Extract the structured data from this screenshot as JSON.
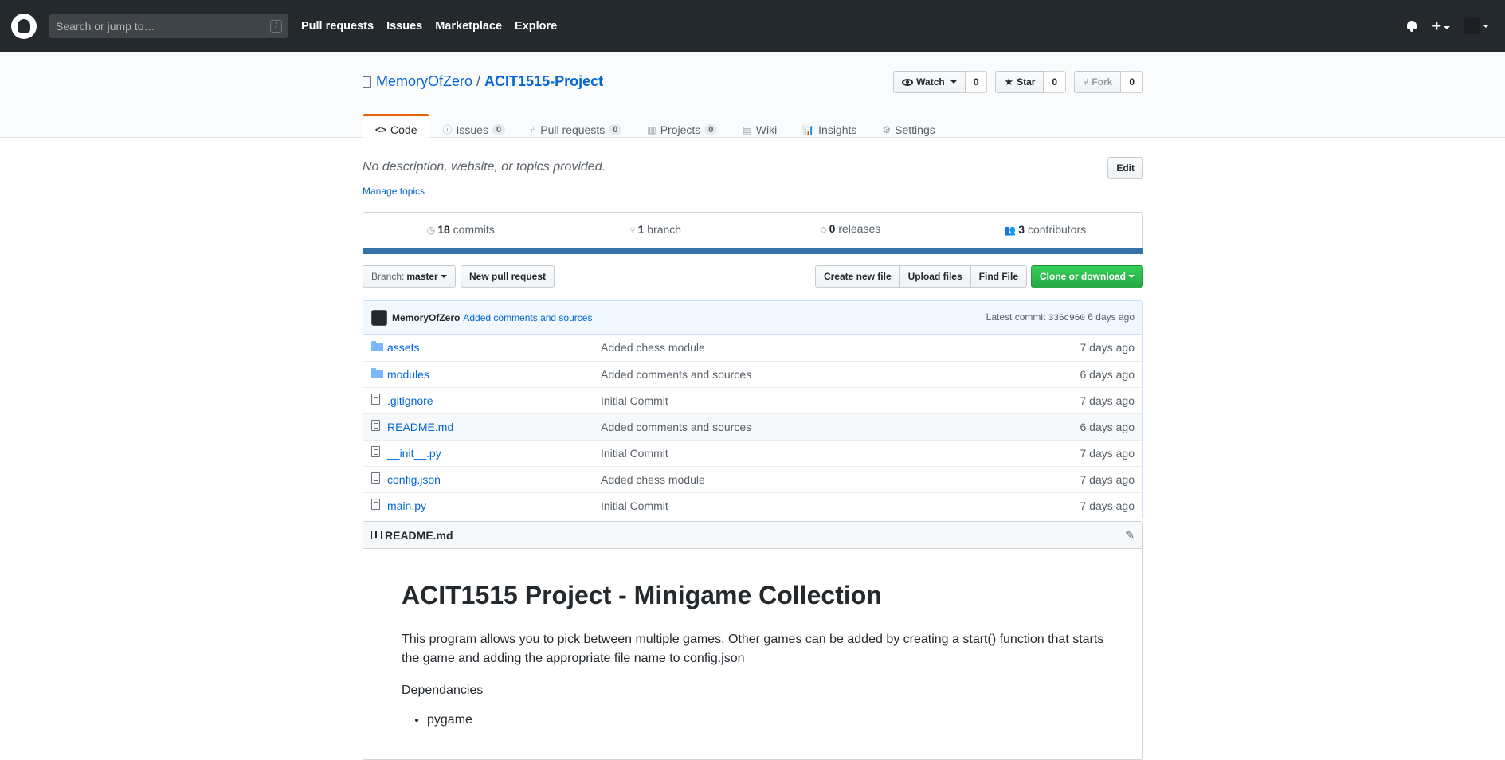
{
  "header": {
    "search_placeholder": "Search or jump to…",
    "slash": "/",
    "nav": [
      "Pull requests",
      "Issues",
      "Marketplace",
      "Explore"
    ],
    "plus": "+"
  },
  "repo": {
    "owner": "MemoryOfZero",
    "separator": "/",
    "name": "ACIT1515-Project",
    "watch_label": "Watch",
    "watch_count": "0",
    "star_label": "Star",
    "star_count": "0",
    "fork_label": "Fork",
    "fork_count": "0",
    "tabs": [
      {
        "label": "Code",
        "icon": "<>",
        "counter": null
      },
      {
        "label": "Issues",
        "icon": "!",
        "counter": "0"
      },
      {
        "label": "Pull requests",
        "icon": "⑃",
        "counter": "0"
      },
      {
        "label": "Projects",
        "icon": "▥",
        "counter": "0"
      },
      {
        "label": "Wiki",
        "icon": "▤",
        "counter": null
      },
      {
        "label": "Insights",
        "icon": "▮",
        "counter": null
      },
      {
        "label": "Settings",
        "icon": "⚙",
        "counter": null
      }
    ]
  },
  "main": {
    "description": "No description, website, or topics provided.",
    "manage_topics": "Manage topics",
    "edit_label": "Edit",
    "summary": {
      "commits_count": "18",
      "commits_label": "commits",
      "branch_count": "1",
      "branch_label": "branch",
      "releases_count": "0",
      "releases_label": "releases",
      "contributors_count": "3",
      "contributors_label": "contributors"
    },
    "lang_color": "#3572A5",
    "branch_prefix": "Branch:",
    "branch_name": "master",
    "new_pr": "New pull request",
    "create_file": "Create new file",
    "upload_files": "Upload files",
    "find_file": "Find File",
    "clone": "Clone or download",
    "commit": {
      "author": "MemoryOfZero",
      "message": "Added comments and sources",
      "latest_prefix": "Latest commit",
      "sha": "336c960",
      "age": "6 days ago"
    },
    "files": [
      {
        "name": "assets",
        "type": "dir",
        "message": "Added chess module",
        "age": "7 days ago"
      },
      {
        "name": "modules",
        "type": "dir",
        "message": "Added comments and sources",
        "age": "6 days ago"
      },
      {
        "name": ".gitignore",
        "type": "file",
        "message": "Initial Commit",
        "age": "7 days ago"
      },
      {
        "name": "README.md",
        "type": "file",
        "message": "Added comments and sources",
        "age": "6 days ago"
      },
      {
        "name": "__init__.py",
        "type": "file",
        "message": "Initial Commit",
        "age": "7 days ago"
      },
      {
        "name": "config.json",
        "type": "file",
        "message": "Added chess module",
        "age": "7 days ago"
      },
      {
        "name": "main.py",
        "type": "file",
        "message": "Initial Commit",
        "age": "7 days ago"
      }
    ]
  },
  "readme": {
    "filename": "README.md",
    "title": "ACIT1515 Project - Minigame Collection",
    "paragraph": "This program allows you to pick between multiple games. Other games can be added by creating a start() function that starts the game and adding the appropriate file name to config.json",
    "deps_heading": "Dependancies",
    "deps": [
      "pygame"
    ]
  }
}
